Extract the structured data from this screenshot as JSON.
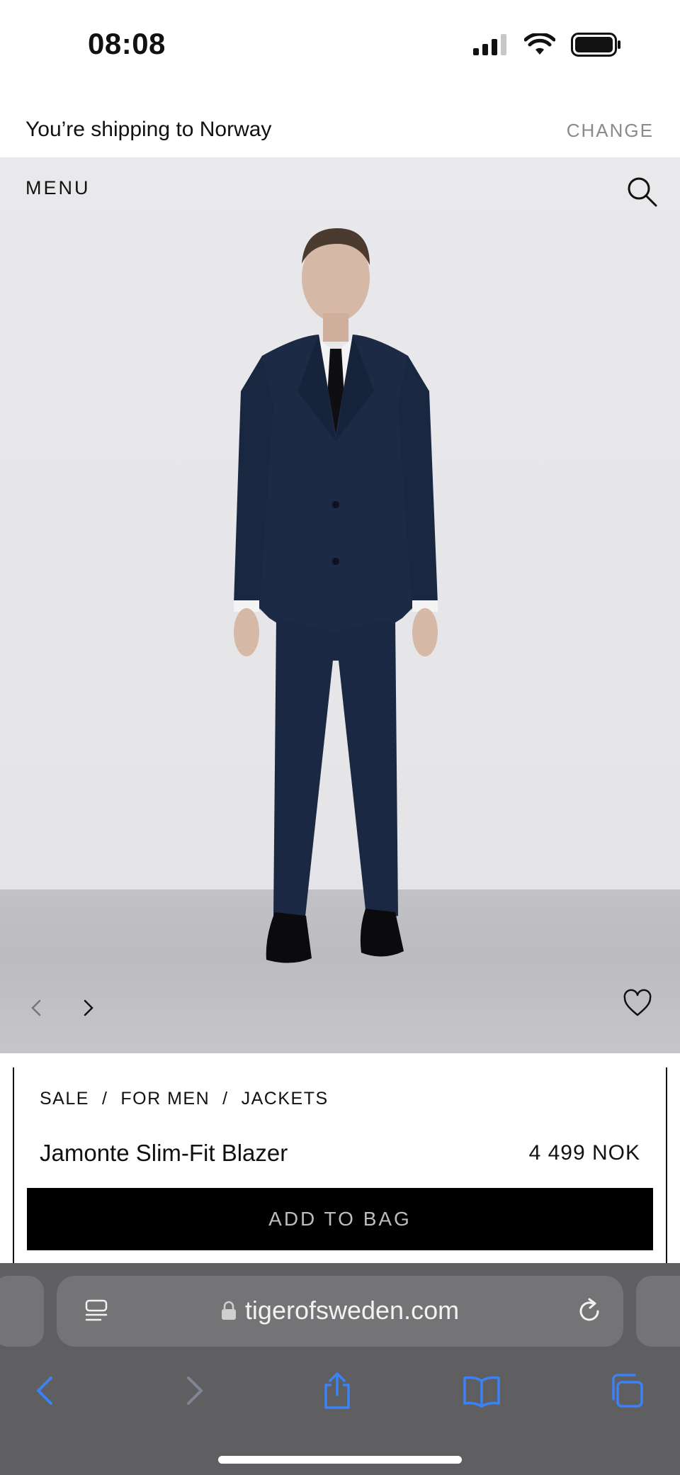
{
  "status_bar": {
    "time": "08:08"
  },
  "shipping_banner": {
    "text": "You’re shipping to Norway",
    "action": "CHANGE"
  },
  "hero": {
    "menu_label": "MENU"
  },
  "product": {
    "breadcrumb": [
      "SALE",
      "/",
      "FOR MEN",
      "/",
      "JACKETS"
    ],
    "name": "Jamonte Slim-Fit Blazer",
    "price": "4 499 NOK",
    "add_to_bag": "ADD TO BAG"
  },
  "browser": {
    "url": "tigerofsweden.com"
  },
  "colors": {
    "accent_blue": "#3b82f6",
    "button_black": "#000000",
    "browser_gray": "#5f5f61",
    "suit_navy": "#1c2a45"
  },
  "icons": [
    "signal-icon",
    "wifi-icon",
    "battery-icon",
    "search-icon",
    "chevron-left-icon",
    "chevron-right-icon",
    "heart-icon",
    "reader-icon",
    "lock-icon",
    "reload-icon",
    "back-icon",
    "forward-icon",
    "share-icon",
    "bookmarks-icon",
    "tabs-icon"
  ]
}
